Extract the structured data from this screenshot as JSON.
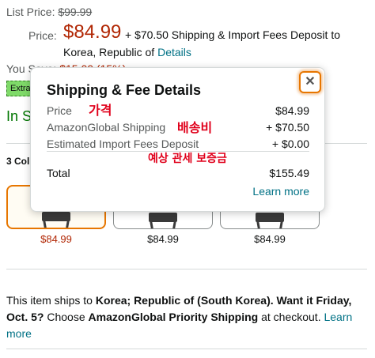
{
  "pricing": {
    "list_label": "List Price:",
    "list_value": "$99.99",
    "price_label": "Price:",
    "price_value": "$84.99",
    "shipping_line1": "+ $70.50 Shipping & Import Fees Deposit to",
    "shipping_line2": "Korea, Republic of ",
    "details_link": "Details",
    "you_save_label": "You Save:",
    "you_save_value": "$15.00 (15%)",
    "deal_badge": "Extra",
    "stock": "In S"
  },
  "colors": {
    "label": "3 Col",
    "swatches": [
      {
        "price": "$84.99",
        "selected": true
      },
      {
        "price": "$84.99",
        "selected": false
      },
      {
        "price": "$84.99",
        "selected": false
      }
    ]
  },
  "popover": {
    "title": "Shipping & Fee Details",
    "close_symbol": "✕",
    "rows": [
      {
        "label": "Price",
        "value": "$84.99"
      },
      {
        "label": "AmazonGlobal Shipping",
        "value": "+ $70.50"
      },
      {
        "label": "Estimated Import Fees Deposit",
        "value": "+ $0.00"
      }
    ],
    "total_label": "Total",
    "total_value": "$155.49",
    "learn_more": "Learn more",
    "annotations": {
      "price": "가격",
      "shipping": "배송비",
      "import": "예상 관세 보증금"
    }
  },
  "shipping_message": {
    "p1": "This item ships to ",
    "dest": "Korea; Republic of (South Korea). Want it Friday, Oct. 5?",
    "p2": " Choose ",
    "method": "AmazonGlobal Priority Shipping",
    "p3": " at checkout. ",
    "link": "Learn more"
  },
  "colors_theme": {
    "price_red": "#b12704",
    "link_teal": "#007185",
    "stock_green": "#007600",
    "focus_orange": "#e77600",
    "annotation_red": "#e0001b"
  }
}
